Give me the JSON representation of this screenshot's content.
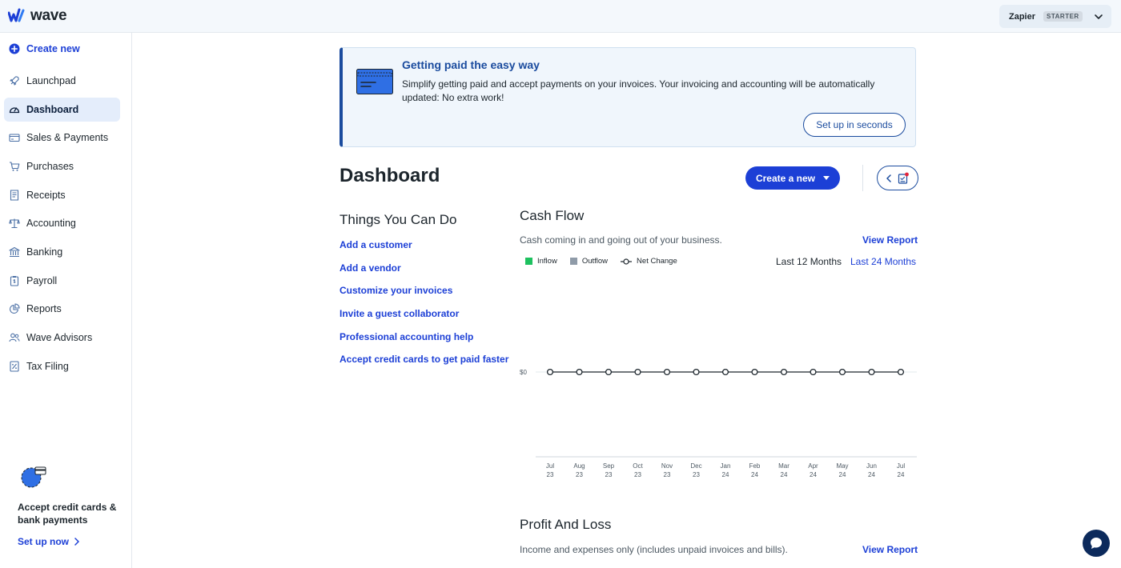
{
  "app": {
    "name": "wave"
  },
  "business": {
    "name": "Zapier",
    "plan": "STARTER"
  },
  "sidebar": {
    "create_label": "Create new",
    "items": [
      {
        "label": "Launchpad",
        "icon": "rocket-icon"
      },
      {
        "label": "Dashboard",
        "icon": "dashboard-icon",
        "active": true
      },
      {
        "label": "Sales & Payments",
        "icon": "card-icon"
      },
      {
        "label": "Purchases",
        "icon": "cart-icon"
      },
      {
        "label": "Receipts",
        "icon": "receipt-icon"
      },
      {
        "label": "Accounting",
        "icon": "scale-icon"
      },
      {
        "label": "Banking",
        "icon": "bank-icon"
      },
      {
        "label": "Payroll",
        "icon": "clipboard-icon"
      },
      {
        "label": "Reports",
        "icon": "pie-chart-icon"
      },
      {
        "label": "Wave Advisors",
        "icon": "people-icon"
      },
      {
        "label": "Tax Filing",
        "icon": "percent-doc-icon"
      }
    ],
    "promo": {
      "text": "Accept credit cards & bank payments",
      "link": "Set up now"
    }
  },
  "banner": {
    "title": "Getting paid the easy way",
    "body": "Simplify getting paid and accept payments on your invoices. Your invoicing and accounting will be automatically updated: No extra work!",
    "button": "Set up in seconds"
  },
  "header": {
    "title": "Dashboard",
    "create_button": "Create a new"
  },
  "things": {
    "title": "Things You Can Do",
    "links": [
      "Add a customer",
      "Add a vendor",
      "Customize your invoices",
      "Invite a guest collaborator",
      "Professional accounting help",
      "Accept credit cards to get paid faster"
    ]
  },
  "cash_flow": {
    "title": "Cash Flow",
    "subtitle": "Cash coming in and going out of your business.",
    "view_report": "View Report",
    "legend": {
      "inflow": "Inflow",
      "outflow": "Outflow",
      "net": "Net Change"
    },
    "range_12": "Last 12 Months",
    "range_24": "Last 24 Months",
    "colors": {
      "inflow": "#1ec15f",
      "outflow": "#8f9ba8",
      "net": "#1c252c"
    }
  },
  "chart_data": {
    "type": "line",
    "y_tick_labels": [
      "$0"
    ],
    "categories": [
      "Jul 23",
      "Aug 23",
      "Sep 23",
      "Oct 23",
      "Nov 23",
      "Dec 23",
      "Jan 24",
      "Feb 24",
      "Mar 24",
      "Apr 24",
      "May 24",
      "Jun 24",
      "Jul 24"
    ],
    "series": [
      {
        "name": "Inflow",
        "values": [
          0,
          0,
          0,
          0,
          0,
          0,
          0,
          0,
          0,
          0,
          0,
          0,
          0
        ]
      },
      {
        "name": "Outflow",
        "values": [
          0,
          0,
          0,
          0,
          0,
          0,
          0,
          0,
          0,
          0,
          0,
          0,
          0
        ]
      },
      {
        "name": "Net Change",
        "values": [
          0,
          0,
          0,
          0,
          0,
          0,
          0,
          0,
          0,
          0,
          0,
          0,
          0
        ]
      }
    ],
    "legend_position": "top-left"
  },
  "profit_loss": {
    "title": "Profit And Loss",
    "subtitle": "Income and expenses only (includes unpaid invoices and bills).",
    "view_report": "View Report"
  }
}
